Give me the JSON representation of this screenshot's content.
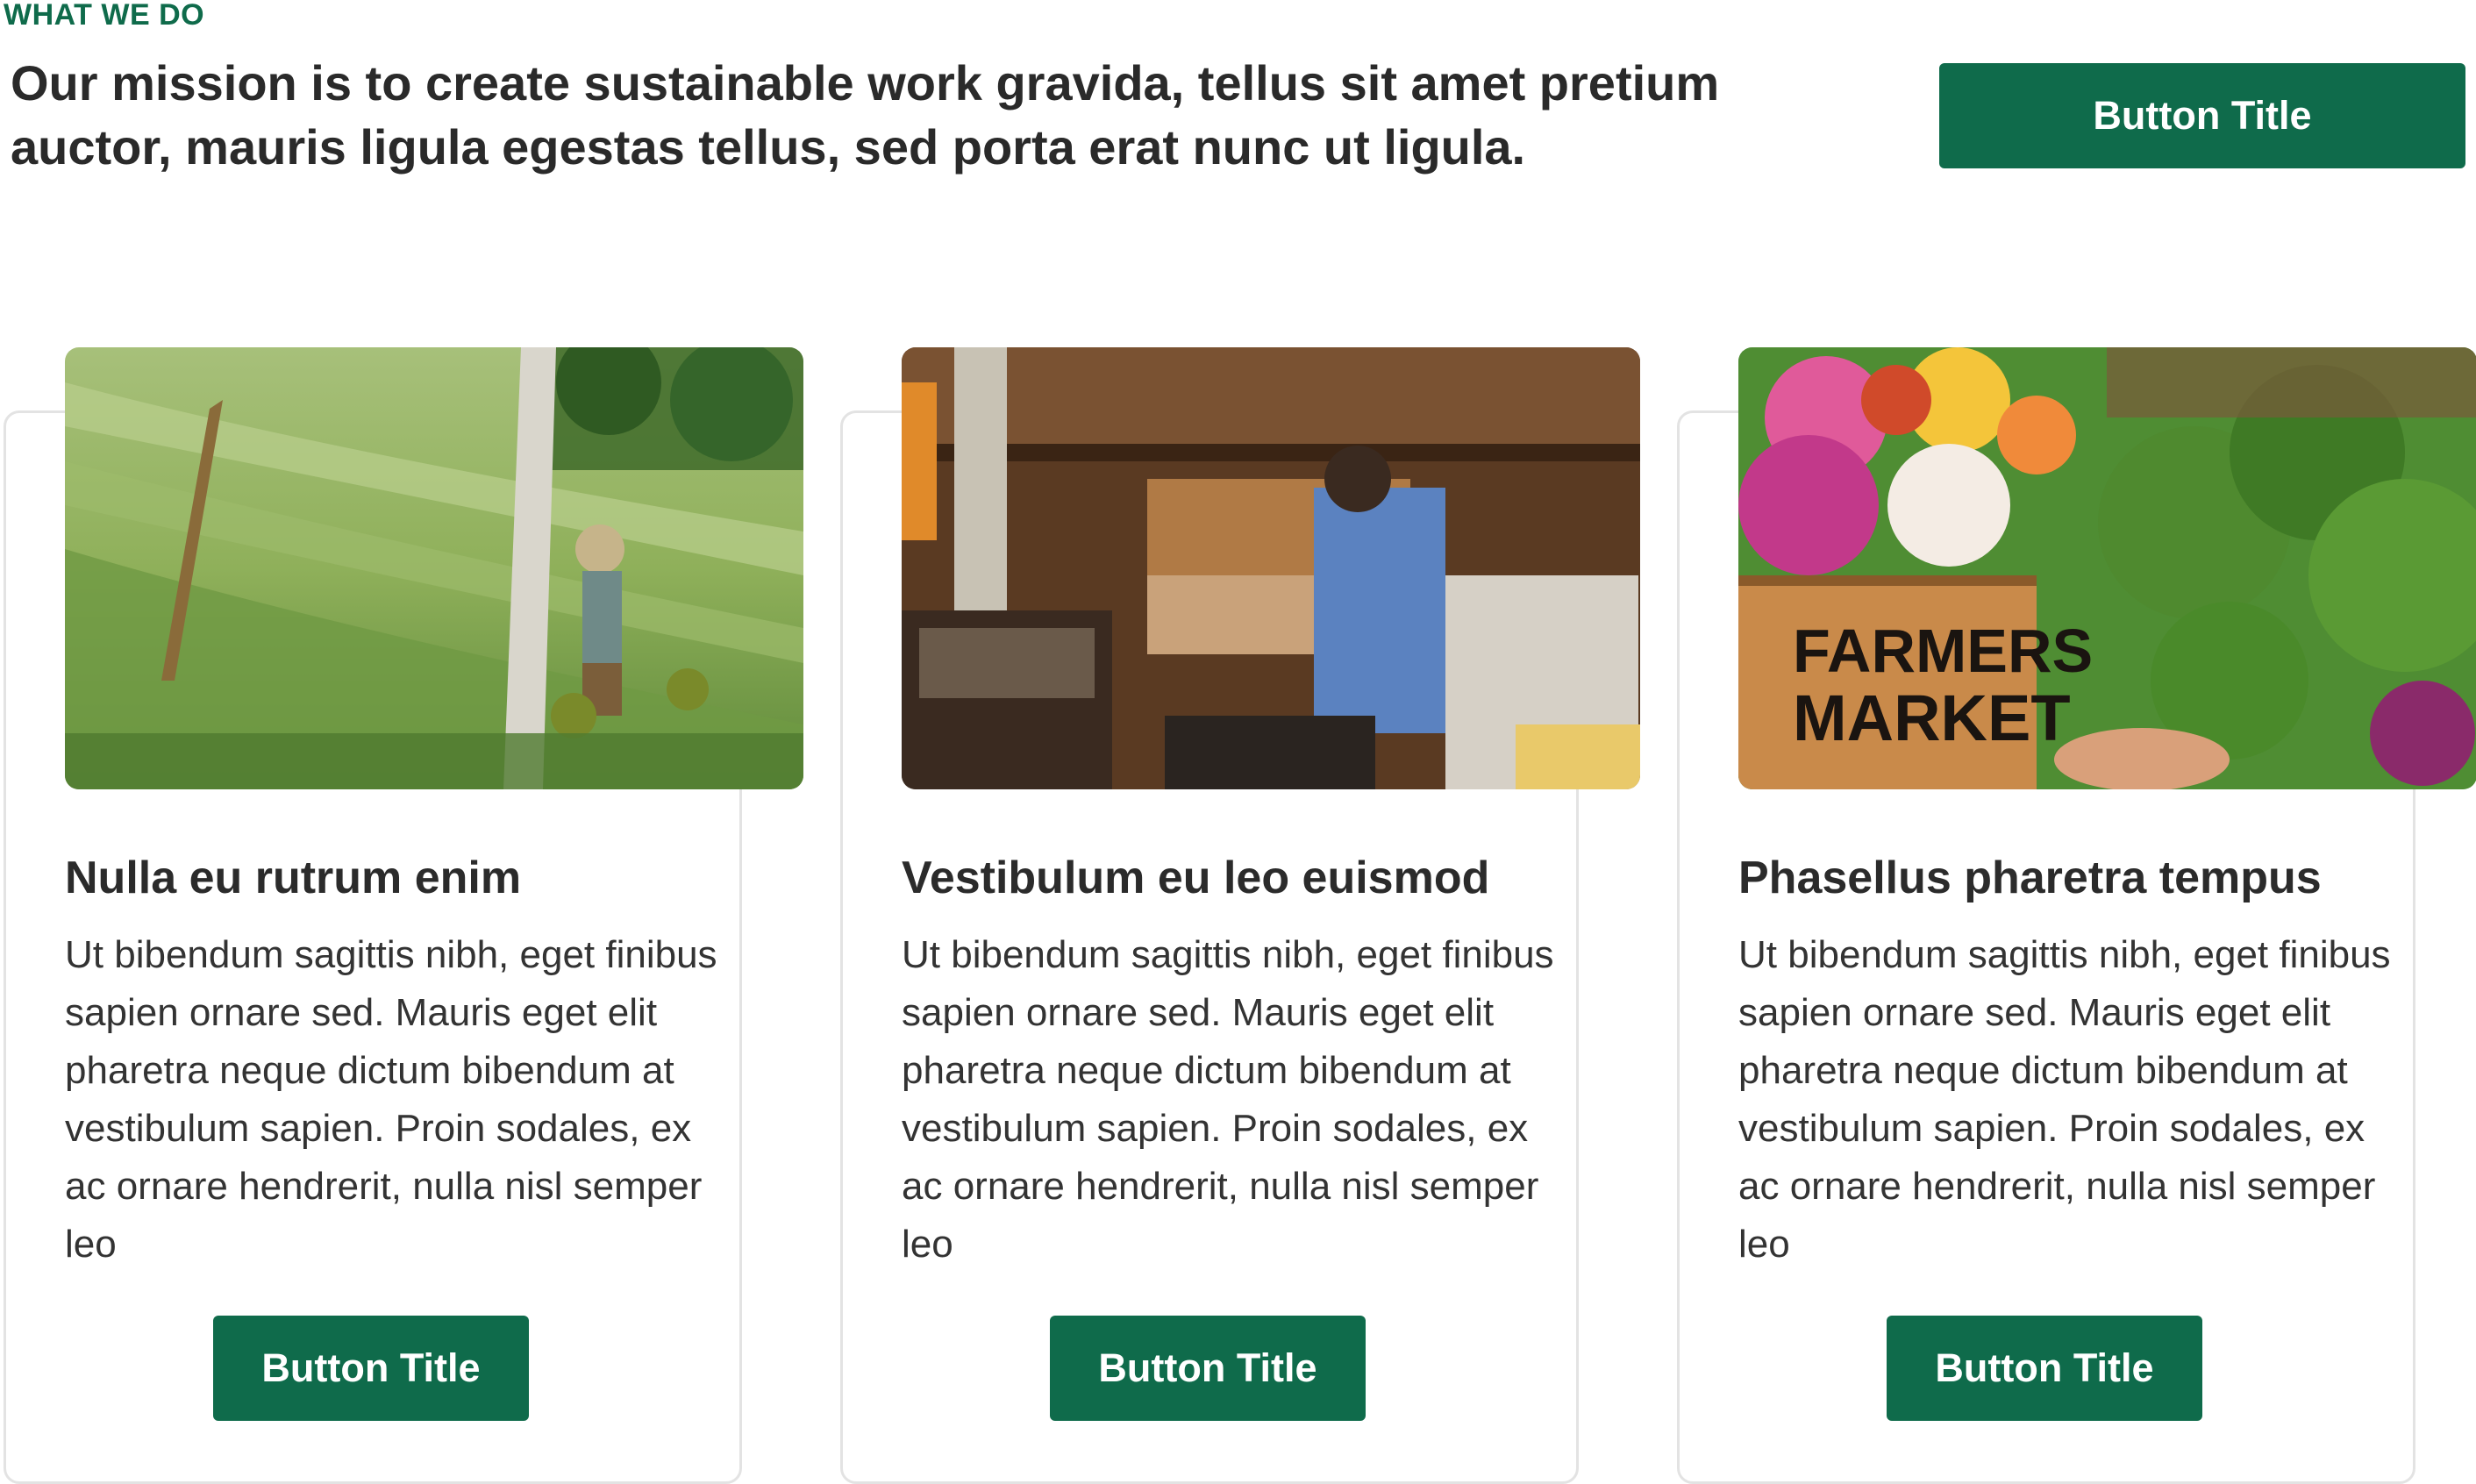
{
  "section": {
    "eyebrow": "WHAT WE DO",
    "mission": "Our mission is to create sustainable work gravida, tellus sit amet pretium auctor, mauris ligula egestas tellus, sed porta erat nunc ut ligula.",
    "button_label": "Button Title"
  },
  "cards": [
    {
      "image": "rice-terrace-farmer-photo",
      "title": "Nulla eu rutrum enim",
      "body": "Ut bibendum sagittis nibh, eget finibus sapien ornare sed. Mauris eget elit pharetra neque dictum bibendum at vestibulum sapien. Proin sodales, ex ac ornare hendrerit, nulla nisl semper leo",
      "button_label": "Button Title"
    },
    {
      "image": "market-stall-vendor-photo",
      "title": "Vestibulum eu leo euismod",
      "body": "Ut bibendum sagittis nibh, eget finibus sapien ornare sed. Mauris eget elit pharetra neque dictum bibendum at vestibulum sapien. Proin sodales, ex ac ornare hendrerit, nulla nisl semper leo",
      "button_label": "Button Title"
    },
    {
      "image": "farmers-market-crate-photo",
      "image_text": [
        "FARMERS",
        "MARKET"
      ],
      "title": "Phasellus pharetra tempus",
      "body": "Ut bibendum sagittis nibh, eget finibus sapien ornare sed. Mauris eget elit pharetra neque dictum bibendum at vestibulum sapien. Proin sodales, ex ac ornare hendrerit, nulla nisl semper leo",
      "button_label": "Button Title"
    }
  ],
  "colors": {
    "accent": "#0f6b4b",
    "text": "#2b2b2b",
    "card_border": "#e3e3e3"
  }
}
